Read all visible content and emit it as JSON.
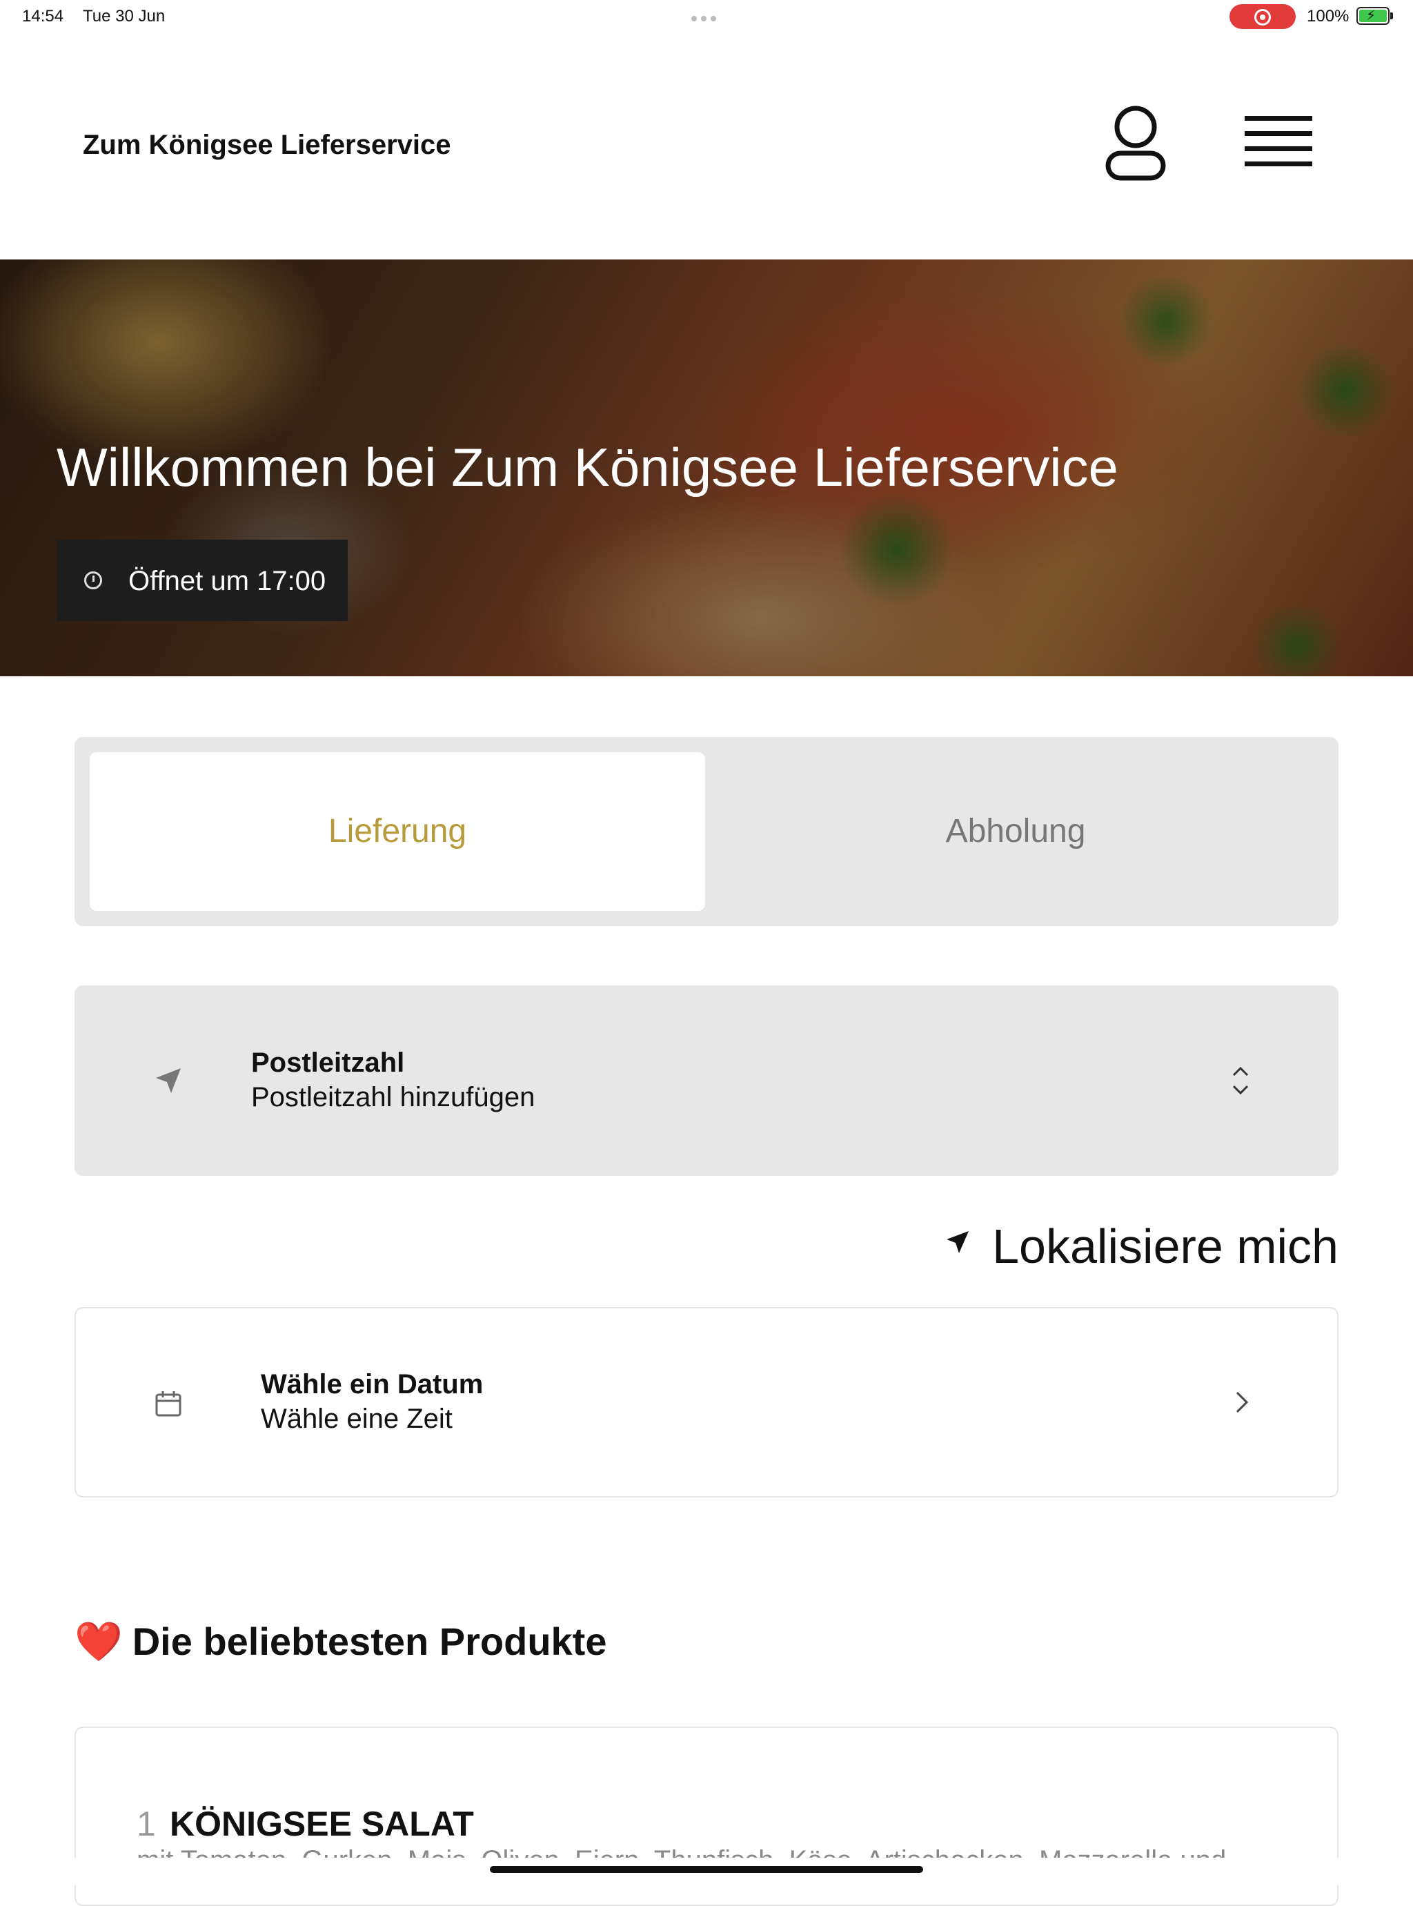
{
  "status_bar": {
    "time": "14:54",
    "date": "Tue 30 Jun",
    "battery": "100%",
    "recording_color": "#e33a3a",
    "battery_color": "#3ec74b"
  },
  "header": {
    "title": "Zum Königsee Lieferservice",
    "user_icon": "user-icon",
    "menu_icon": "hamburger-menu-icon"
  },
  "hero": {
    "title": "Willkommen bei Zum Königsee Lieferservice",
    "open_status": "Öffnet um 17:00",
    "clock_icon": "clock-icon"
  },
  "mode": {
    "tabs": [
      {
        "label": "Lieferung",
        "active": true
      },
      {
        "label": "Abholung",
        "active": false
      }
    ],
    "accent_color": "#b79b3a"
  },
  "postcode": {
    "label": "Postleitzahl",
    "value": "Postleitzahl hinzufügen",
    "icon": "location-arrow-icon"
  },
  "locate": {
    "label": "Lokalisiere mich",
    "icon": "location-arrow-icon"
  },
  "schedule": {
    "label": "Wähle ein Datum",
    "value": "Wähle eine Zeit",
    "icon": "calendar-icon"
  },
  "popular": {
    "heart": "❤️",
    "title": "Die beliebtesten Produkte",
    "products": [
      {
        "number": "1",
        "name": "KÖNIGSEE SALAT",
        "description": "mit Tomaten, Gurken, Mais, Oliven, Eiern, Thunfisch, Käse, Artischocken, Mozzarella und"
      }
    ]
  }
}
